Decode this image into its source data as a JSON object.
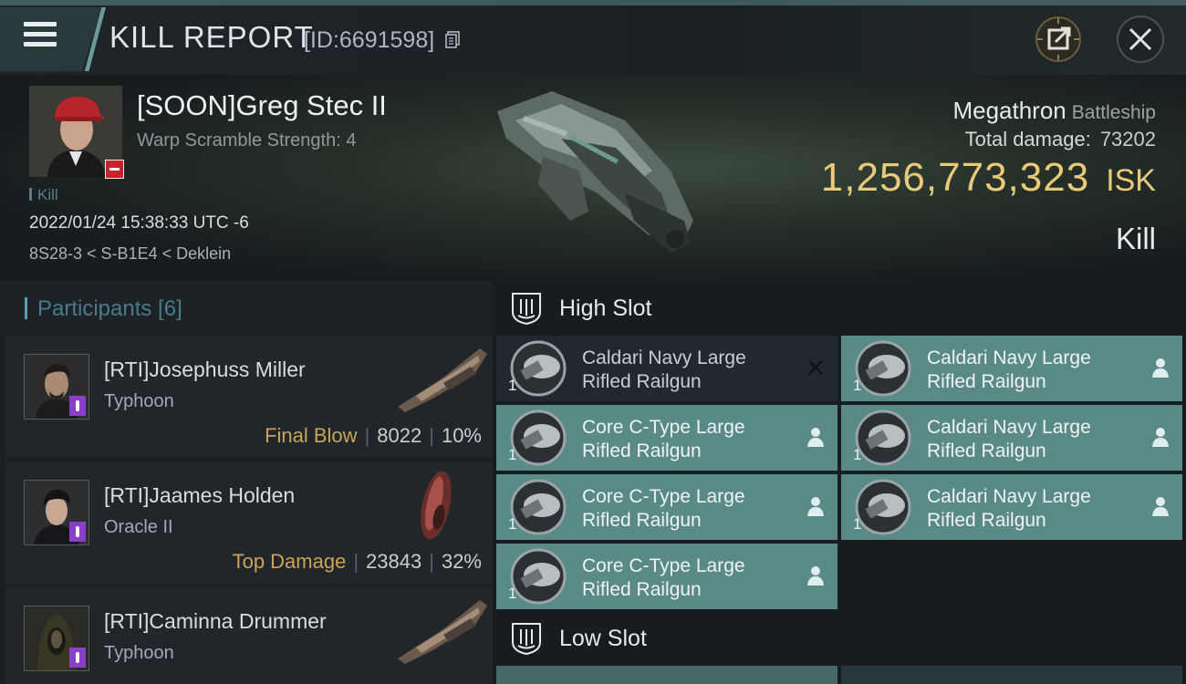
{
  "header": {
    "title": "KILL REPORT",
    "report_id": "[ID:6691598]"
  },
  "victim": {
    "name": "[SOON]Greg Stec II",
    "warp_scramble": "Warp Scramble Strength: 4",
    "kill_tag": "Kill",
    "timestamp": "2022/01/24 15:38:33 UTC -6",
    "location": "8S28-3 < S-B1E4 < Deklein",
    "ship_name": "Megathron",
    "ship_class": "Battleship",
    "total_damage_label": "Total damage:",
    "total_damage_value": "73202",
    "isk_value": "1,256,773,323",
    "isk_unit": "ISK",
    "result": "Kill"
  },
  "participants": {
    "title": "Participants [6]",
    "items": [
      {
        "name": "[RTI]Josephuss Miller",
        "ship": "Typhoon",
        "tag": "Final Blow",
        "damage": "8022",
        "percent": "10%"
      },
      {
        "name": "[RTI]Jaames Holden",
        "ship": "Oracle II",
        "tag": "Top Damage",
        "damage": "23843",
        "percent": "32%"
      },
      {
        "name": "[RTI]Caminna Drummer",
        "ship": "Typhoon",
        "tag": "",
        "damage": "",
        "percent": ""
      }
    ]
  },
  "slots": {
    "high_slot_title": "High Slot",
    "low_slot_title": "Low Slot",
    "high_modules": [
      {
        "line1": "Caldari Navy Large",
        "line2": "Rifled Railgun",
        "qty": "1",
        "state": "destroyed"
      },
      {
        "line1": "Caldari Navy Large",
        "line2": "Rifled Railgun",
        "qty": "1",
        "state": "dropped"
      },
      {
        "line1": "Core C-Type Large",
        "line2": "Rifled Railgun",
        "qty": "1",
        "state": "dropped"
      },
      {
        "line1": "Caldari Navy Large",
        "line2": "Rifled Railgun",
        "qty": "1",
        "state": "dropped"
      },
      {
        "line1": "Core C-Type Large",
        "line2": "Rifled Railgun",
        "qty": "1",
        "state": "dropped"
      },
      {
        "line1": "Caldari Navy Large",
        "line2": "Rifled Railgun",
        "qty": "1",
        "state": "dropped"
      },
      {
        "line1": "Core C-Type Large",
        "line2": "Rifled Railgun",
        "qty": "1",
        "state": "dropped"
      }
    ]
  },
  "colors": {
    "accent_gold": "#e9c97a",
    "fitted_module_bg": "#5a8a86",
    "corp_badge_red": "#c8232a",
    "alliance_badge_purple": "#8a3fc9"
  },
  "icons": [
    "menu-icon",
    "copy-icon",
    "share-icon",
    "close-icon",
    "high-slot-icon",
    "low-slot-icon",
    "destroyed-x-icon",
    "dropped-person-icon",
    "railgun-icon"
  ]
}
